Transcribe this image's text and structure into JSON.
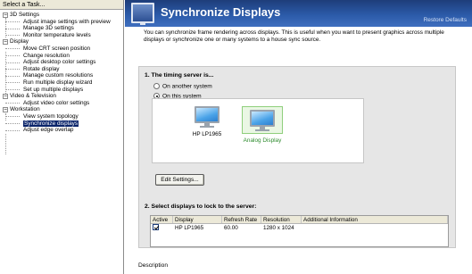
{
  "left_panel": {
    "header": "Select a Task...",
    "tree": [
      {
        "label": "3D Settings",
        "expander": "−",
        "children": [
          {
            "label": "Adjust image settings with preview"
          },
          {
            "label": "Manage 3D settings"
          },
          {
            "label": "Monitor temperature levels"
          }
        ]
      },
      {
        "label": "Display",
        "expander": "−",
        "children": [
          {
            "label": "Move CRT screen position"
          },
          {
            "label": "Change resolution"
          },
          {
            "label": "Adjust desktop color settings"
          },
          {
            "label": "Rotate display"
          },
          {
            "label": "Manage custom resolutions"
          },
          {
            "label": "Run multiple display wizard"
          },
          {
            "label": "Set up multiple displays"
          }
        ]
      },
      {
        "label": "Video & Television",
        "expander": "−",
        "children": [
          {
            "label": "Adjust video color settings"
          }
        ]
      },
      {
        "label": "Workstation",
        "expander": "−",
        "children": [
          {
            "label": "View system topology"
          },
          {
            "label": "Synchronize displays",
            "selected": true
          },
          {
            "label": "Adjust edge overlap"
          }
        ]
      }
    ]
  },
  "header": {
    "icon": "monitor-logo-icon",
    "title": "Synchronize Displays",
    "restore_link": "Restore Defaults"
  },
  "intro_text": "You can synchronize frame rendering across displays. This is useful when you want to present graphics across multiple displays or synchronize one or many systems to a house sync source.",
  "timing_section": {
    "heading": "1. The timing server is...",
    "options": [
      {
        "label": "On another system",
        "selected": false
      },
      {
        "label": "On this system",
        "selected": true
      }
    ],
    "displays": [
      {
        "label": "HP LP1965",
        "selected": false,
        "icon": "monitor-icon"
      },
      {
        "label": "Analog Display",
        "selected": true,
        "icon": "monitor-icon"
      }
    ],
    "edit_button": "Edit Settings..."
  },
  "lock_section": {
    "heading": "2. Select displays to lock to the server:",
    "columns": [
      "Active",
      "Display",
      "Refresh Rate",
      "Resolution",
      "Additional Information"
    ],
    "rows": [
      {
        "active": true,
        "display": "HP LP1965",
        "refresh": "60.00",
        "resolution": "1280 x 1024",
        "info": ""
      }
    ]
  },
  "description_label": "Description",
  "colors": {
    "banner": "#2b5aa8",
    "selection": "#0a246a",
    "panel_bg": "#e6e6e6",
    "selected_display_text": "#2e8b2e"
  }
}
